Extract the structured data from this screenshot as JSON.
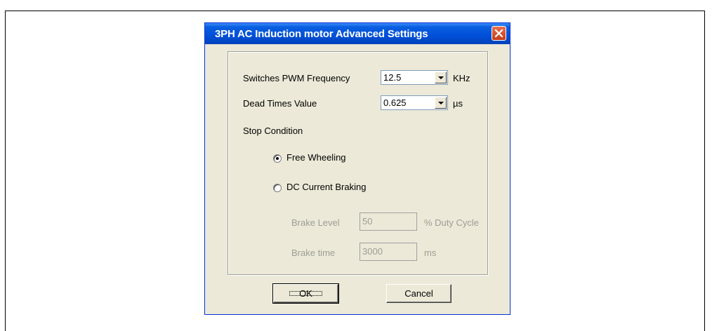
{
  "dialog": {
    "title": "3PH AC Induction motor Advanced Settings",
    "pwm_label": "Switches PWM Frequency",
    "pwm_value": "12.5",
    "pwm_unit": "KHz",
    "dead_label": "Dead Times Value",
    "dead_value": "0.625",
    "dead_unit": "µs",
    "stop_label": "Stop Condition",
    "free_wheeling_label": "Free Wheeling",
    "free_wheeling_checked": true,
    "dc_braking_label": "DC Current Braking",
    "dc_braking_checked": false,
    "brake_level_label": "Brake Level",
    "brake_level_value": "50",
    "brake_level_unit": "% Duty Cycle",
    "brake_time_label": "Brake time",
    "brake_time_value": "3000",
    "brake_time_unit": "ms",
    "ok_label": "OK",
    "cancel_label": "Cancel"
  },
  "colors": {
    "title_bar": "#0050d8",
    "dialog_bg": "#ece9d8",
    "disabled_text": "#9d9d94"
  }
}
